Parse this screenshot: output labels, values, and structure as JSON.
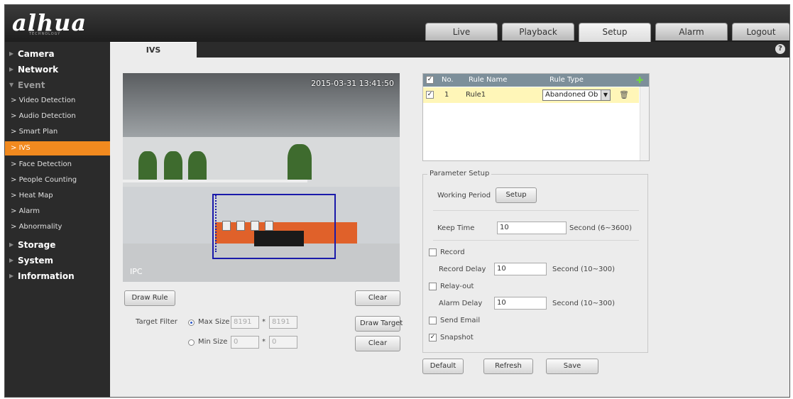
{
  "brand": {
    "logo_text": "alhua",
    "logo_sub": "TECHNOLOGY"
  },
  "header": {
    "tabs": [
      {
        "label": "Live",
        "active": false
      },
      {
        "label": "Playback",
        "active": false
      },
      {
        "label": "Setup",
        "active": true
      },
      {
        "label": "Alarm",
        "active": false
      },
      {
        "label": "Logout",
        "active": false
      }
    ]
  },
  "sidebar": {
    "top_items": [
      "Camera",
      "Network",
      "Event",
      "Storage",
      "System",
      "Information"
    ],
    "event_subitems": [
      "Video Detection",
      "Audio Detection",
      "Smart Plan",
      "IVS",
      "Face Detection",
      "People Counting",
      "Heat Map",
      "Alarm",
      "Abnormality"
    ],
    "active_subitem": "IVS"
  },
  "content": {
    "tab_label": "IVS",
    "help_icon": "?",
    "video": {
      "timestamp": "2015-03-31 13:41:50",
      "label": "IPC"
    },
    "draw_rule_button": "Draw Rule",
    "clear_button": "Clear",
    "draw_target_button": "Draw Target",
    "clear_target_button": "Clear",
    "target_filter": {
      "label": "Target Filter",
      "max_size_label": "Max Size",
      "max_w": "8191",
      "max_h": "8191",
      "min_size_label": "Min Size",
      "min_w": "0",
      "min_h": "0",
      "times": "*",
      "selected": "Max Size"
    }
  },
  "rule_table": {
    "headers": {
      "no": "No.",
      "name": "Rule Name",
      "type": "Rule Type"
    },
    "rows": [
      {
        "checked": true,
        "no": "1",
        "name": "Rule1",
        "type": "Abandoned Ob"
      }
    ]
  },
  "params": {
    "legend": "Parameter Setup",
    "working_period_label": "Working Period",
    "setup_button": "Setup",
    "keep_time_label": "Keep Time",
    "keep_time_value": "10",
    "keep_time_unit": "Second (6~3600)",
    "record_label": "Record",
    "record_checked": false,
    "record_delay_label": "Record Delay",
    "record_delay_value": "10",
    "record_delay_unit": "Second (10~300)",
    "relay_label": "Relay-out",
    "relay_checked": false,
    "alarm_delay_label": "Alarm Delay",
    "alarm_delay_value": "10",
    "alarm_delay_unit": "Second (10~300)",
    "email_label": "Send Email",
    "email_checked": false,
    "snapshot_label": "Snapshot",
    "snapshot_checked": true
  },
  "footer": {
    "default_button": "Default",
    "refresh_button": "Refresh",
    "save_button": "Save"
  },
  "colors": {
    "accent": "#f28a1f",
    "rule_box": "#1a1aaa",
    "row_highlight": "#fff6b8"
  }
}
